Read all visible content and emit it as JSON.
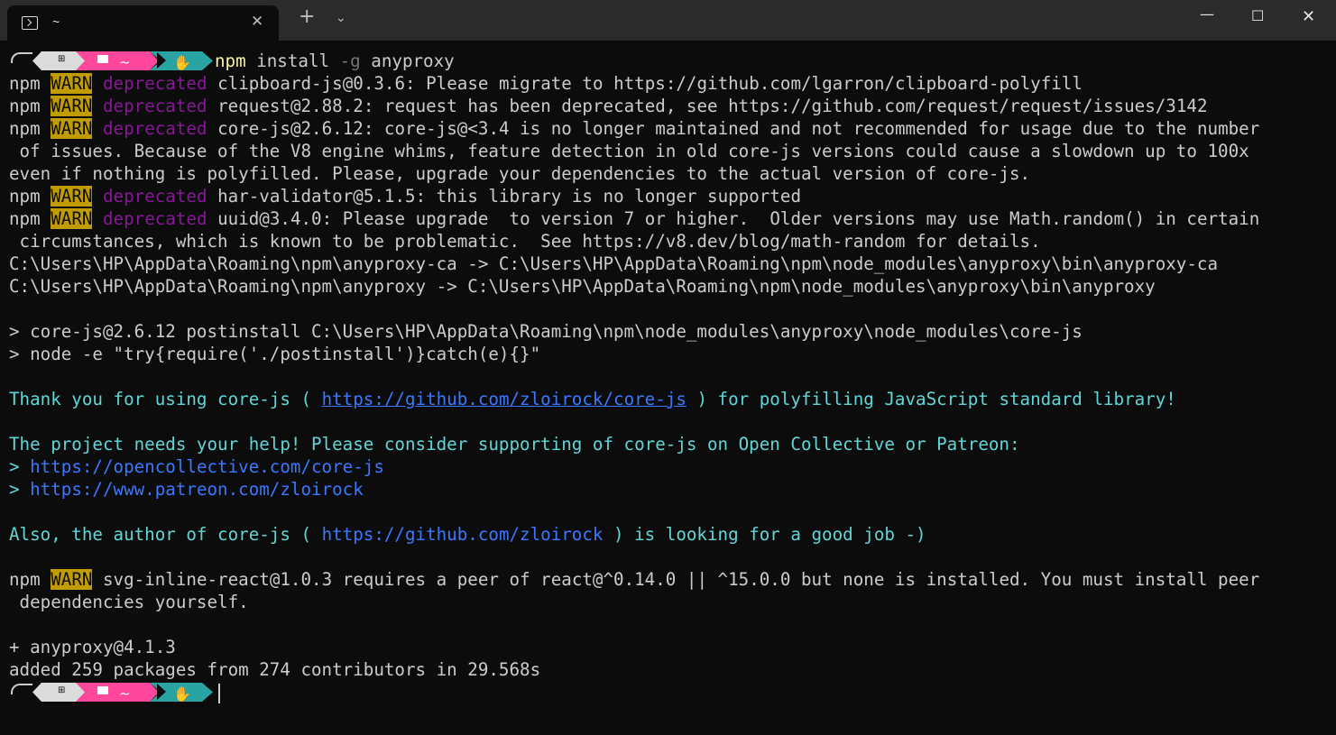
{
  "window": {
    "tab_title": "~",
    "close_tab_glyph": "✕",
    "new_tab_glyph": "+",
    "dropdown_glyph": "⌄",
    "min_glyph": "—",
    "max_glyph": "☐",
    "close_glyph": "✕"
  },
  "prompt": {
    "path": "~",
    "command": "npm",
    "args": " install ",
    "flag": "-g",
    "package": " anyproxy"
  },
  "labels": {
    "npm": "npm",
    "warn": "WARN",
    "deprecated": "deprecated"
  },
  "warnings": [
    "clipboard-js@0.3.6: Please migrate to https://github.com/lgarron/clipboard-polyfill",
    "request@2.88.2: request has been deprecated, see https://github.com/request/request/issues/3142",
    "core-js@2.6.12: core-js@<3.4 is no longer maintained and not recommended for usage due to the number",
    " of issues. Because of the V8 engine whims, feature detection in old core-js versions could cause a slowdown up to 100x",
    "even if nothing is polyfilled. Please, upgrade your dependencies to the actual version of core-js.",
    "har-validator@5.1.5: this library is no longer supported",
    "uuid@3.4.0: Please upgrade  to version 7 or higher.  Older versions may use Math.random() in certain",
    " circumstances, which is known to be problematic.  See https://v8.dev/blog/math-random for details."
  ],
  "links": [
    "C:\\Users\\HP\\AppData\\Roaming\\npm\\anyproxy-ca -> C:\\Users\\HP\\AppData\\Roaming\\npm\\node_modules\\anyproxy\\bin\\anyproxy-ca",
    "C:\\Users\\HP\\AppData\\Roaming\\npm\\anyproxy -> C:\\Users\\HP\\AppData\\Roaming\\npm\\node_modules\\anyproxy\\bin\\anyproxy"
  ],
  "postinstall": [
    "> core-js@2.6.12 postinstall C:\\Users\\HP\\AppData\\Roaming\\npm\\node_modules\\anyproxy\\node_modules\\core-js",
    "> node -e \"try{require('./postinstall')}catch(e){}\""
  ],
  "thanks": {
    "pre": "Thank you for using core-js ( ",
    "url": "https://github.com/zloirock/core-js",
    "post": " ) for polyfilling JavaScript standard library!"
  },
  "help": {
    "text": "The project needs your help! Please consider supporting of core-js on Open Collective or Patreon:",
    "bullet": "> ",
    "url1": "https://opencollective.com/core-js",
    "url2": "https://www.patreon.com/zloirock"
  },
  "author": {
    "pre": "Also, the author of core-js ( ",
    "url": "https://github.com/zloirock",
    "post": " ) is looking for a good job -)"
  },
  "peer": {
    "line1": " svg-inline-react@1.0.3 requires a peer of react@^0.14.0 || ^15.0.0 but none is installed. You must install peer",
    "line2": " dependencies yourself."
  },
  "summary": {
    "installed": "+ anyproxy@4.1.3",
    "added": "added 259 packages from 274 contributors in 29.568s"
  },
  "colors": {
    "background": "#0c0c0c",
    "warn_bg": "#c19c00",
    "deprecated": "#881798",
    "cyan": "#61d6d6",
    "link": "#3b78ff",
    "prompt_pink": "#ff479c",
    "prompt_teal": "#2aa3a3"
  }
}
